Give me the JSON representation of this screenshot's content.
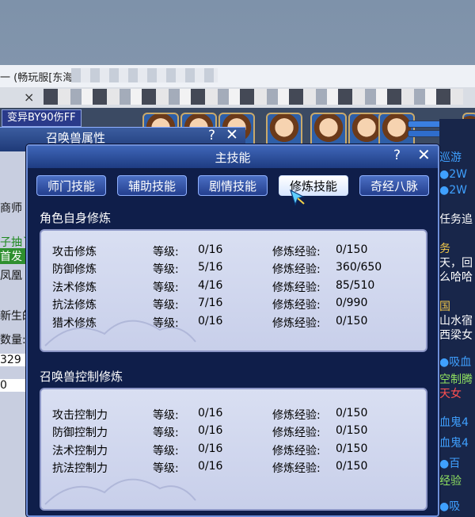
{
  "host_window": {
    "title": "一 (畅玩服[东海",
    "close_glyph": "×"
  },
  "game_top": {
    "transform_label": "变异BY90伤FF"
  },
  "chat_lines": [
    {
      "text": "巡游",
      "color": "#3fa0ff"
    },
    {
      "text": "●2W",
      "color": "#3fa0ff"
    },
    {
      "text": "●2W",
      "color": "#3fa0ff"
    },
    {
      "text": "任务追",
      "color": "#ffffff"
    },
    {
      "text": "务",
      "color": "#f2c84a"
    },
    {
      "text": "天，回",
      "color": "#ffffff"
    },
    {
      "text": "么哈哈",
      "color": "#ffffff"
    },
    {
      "text": "国",
      "color": "#f2c84a"
    },
    {
      "text": "山水宿",
      "color": "#ffffff"
    },
    {
      "text": "西梁女",
      "color": "#ffffff"
    },
    {
      "text": "●吸血",
      "color": "#3fa0ff"
    },
    {
      "text": "空制腾",
      "color": "#8fe060"
    },
    {
      "text": "天女",
      "color": "#ff5050"
    },
    {
      "text": "血鬼4",
      "color": "#3fa0ff"
    },
    {
      "text": "血鬼4",
      "color": "#3fa0ff"
    },
    {
      "text": "●百",
      "color": "#3fa0ff"
    },
    {
      "text": "经验",
      "color": "#8fe060"
    },
    {
      "text": "●吸",
      "color": "#3fa0ff"
    }
  ],
  "left_lines": [
    {
      "text": "商师",
      "color": "#111111"
    },
    {
      "text": "子抽丫",
      "color": "#1f8a1f"
    },
    {
      "text": "首发",
      "color": "#ffffff"
    },
    {
      "text": "凤凰",
      "color": "#111111"
    },
    {
      "text": "新生的",
      "color": "#111111"
    },
    {
      "text": "数量:",
      "color": "#111111"
    },
    {
      "text": "329",
      "color": "#111111"
    },
    {
      "text": "0",
      "color": "#111111"
    }
  ],
  "pet_window": {
    "title": "召唤兽属性",
    "help": "?",
    "close": "✕"
  },
  "main_window": {
    "title": "主技能",
    "help": "?",
    "close": "✕",
    "tabs": [
      {
        "label": "师门技能",
        "active": false
      },
      {
        "label": "辅助技能",
        "active": false
      },
      {
        "label": "剧情技能",
        "active": false
      },
      {
        "label": "修炼技能",
        "active": true
      },
      {
        "label": "奇经八脉",
        "active": false
      }
    ],
    "self_section": {
      "title": "角色自身修炼",
      "rows": [
        {
          "name": "攻击修炼",
          "level_label": "等级:",
          "level": "0/16",
          "exp_label": "修炼经验:",
          "exp": "0/150"
        },
        {
          "name": "防御修炼",
          "level_label": "等级:",
          "level": "5/16",
          "exp_label": "修炼经验:",
          "exp": "360/650"
        },
        {
          "name": "法术修炼",
          "level_label": "等级:",
          "level": "4/16",
          "exp_label": "修炼经验:",
          "exp": "85/510"
        },
        {
          "name": "抗法修炼",
          "level_label": "等级:",
          "level": "7/16",
          "exp_label": "修炼经验:",
          "exp": "0/990"
        },
        {
          "name": "猎术修炼",
          "level_label": "等级:",
          "level": "0/16",
          "exp_label": "修炼经验:",
          "exp": "0/150"
        }
      ]
    },
    "pet_section": {
      "title": "召唤兽控制修炼",
      "rows": [
        {
          "name": "攻击控制力",
          "level_label": "等级:",
          "level": "0/16",
          "exp_label": "修炼经验:",
          "exp": "0/150"
        },
        {
          "name": "防御控制力",
          "level_label": "等级:",
          "level": "0/16",
          "exp_label": "修炼经验:",
          "exp": "0/150"
        },
        {
          "name": "法术控制力",
          "level_label": "等级:",
          "level": "0/16",
          "exp_label": "修炼经验:",
          "exp": "0/150"
        },
        {
          "name": "抗法控制力",
          "level_label": "等级:",
          "level": "0/16",
          "exp_label": "修炼经验:",
          "exp": "0/150"
        }
      ]
    }
  }
}
